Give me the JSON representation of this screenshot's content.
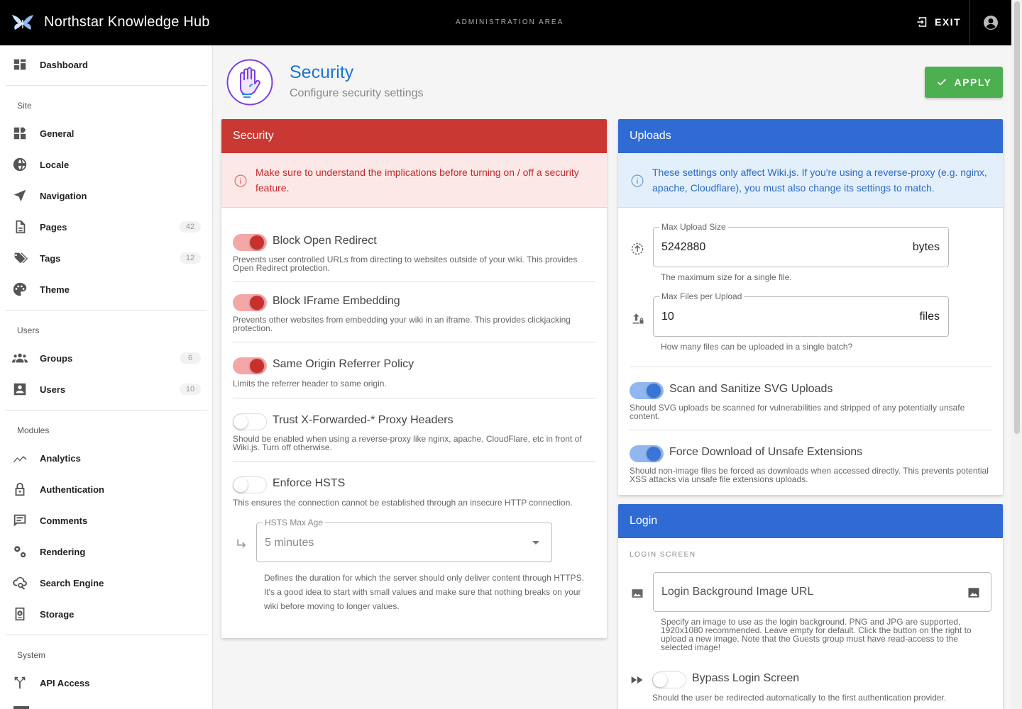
{
  "header": {
    "title": "Northstar Knowledge Hub",
    "area": "ADMINISTRATION AREA",
    "exit_label": "EXIT"
  },
  "sidebar": {
    "dashboard": "Dashboard",
    "site_header": "Site",
    "site_items": [
      {
        "label": "General",
        "icon": "general-icon"
      },
      {
        "label": "Locale",
        "icon": "globe-icon"
      },
      {
        "label": "Navigation",
        "icon": "navigation-icon"
      },
      {
        "label": "Pages",
        "icon": "page-icon",
        "count": "42"
      },
      {
        "label": "Tags",
        "icon": "tag-icon",
        "count": "12"
      },
      {
        "label": "Theme",
        "icon": "palette-icon"
      }
    ],
    "users_header": "Users",
    "users_items": [
      {
        "label": "Groups",
        "icon": "groups-icon",
        "count": "6"
      },
      {
        "label": "Users",
        "icon": "user-icon",
        "count": "10"
      }
    ],
    "modules_header": "Modules",
    "modules_items": [
      {
        "label": "Analytics",
        "icon": "analytics-icon"
      },
      {
        "label": "Authentication",
        "icon": "lock-icon"
      },
      {
        "label": "Comments",
        "icon": "comment-icon"
      },
      {
        "label": "Rendering",
        "icon": "gears-icon"
      },
      {
        "label": "Search Engine",
        "icon": "search-icon"
      },
      {
        "label": "Storage",
        "icon": "storage-icon"
      }
    ],
    "system_header": "System",
    "system_items": [
      {
        "label": "API Access",
        "icon": "api-icon"
      }
    ]
  },
  "page": {
    "title": "Security",
    "subtitle": "Configure security settings",
    "apply_label": "APPLY"
  },
  "security": {
    "header": "Security",
    "alert": "Make sure to understand the implications before turning on / off a security feature.",
    "settings": [
      {
        "label": "Block Open Redirect",
        "hint": "Prevents user controlled URLs from directing to websites outside of your wiki. This provides Open Redirect protection.",
        "on": true
      },
      {
        "label": "Block IFrame Embedding",
        "hint": "Prevents other websites from embedding your wiki in an iframe. This provides clickjacking protection.",
        "on": true
      },
      {
        "label": "Same Origin Referrer Policy",
        "hint": "Limits the referrer header to same origin.",
        "on": true
      },
      {
        "label": "Trust X-Forwarded-* Proxy Headers",
        "hint": "Should be enabled when using a reverse-proxy like nginx, apache, CloudFlare, etc in front of Wiki.js. Turn off otherwise.",
        "on": false
      },
      {
        "label": "Enforce HSTS",
        "hint": "This ensures the connection cannot be established through an insecure HTTP connection.",
        "on": false
      }
    ],
    "hsts": {
      "label": "HSTS Max Age",
      "value": "5 minutes",
      "hint1": "Defines the duration for which the server should only deliver content through HTTPS.",
      "hint2": "It's a good idea to start with small values and make sure that nothing breaks on your wiki before moving to longer values."
    }
  },
  "uploads": {
    "header": "Uploads",
    "alert": "These settings only affect Wiki.js. If you're using a reverse-proxy (e.g. nginx, apache, Cloudflare), you must also change its settings to match.",
    "max_size": {
      "label": "Max Upload Size",
      "value": "5242880",
      "suffix": "bytes",
      "hint": "The maximum size for a single file."
    },
    "max_files": {
      "label": "Max Files per Upload",
      "value": "10",
      "suffix": "files",
      "hint": "How many files can be uploaded in a single batch?"
    },
    "settings": [
      {
        "label": "Scan and Sanitize SVG Uploads",
        "hint": "Should SVG uploads be scanned for vulnerabilities and stripped of any potentially unsafe content.",
        "on": true
      },
      {
        "label": "Force Download of Unsafe Extensions",
        "hint": "Should non-image files be forced as downloads when accessed directly. This prevents potential XSS attacks via unsafe file extensions uploads.",
        "on": true
      }
    ]
  },
  "login": {
    "header": "Login",
    "section": "LOGIN SCREEN",
    "bg_placeholder": "Login Background Image URL",
    "bg_hint": "Specify an image to use as the login background. PNG and JPG are supported, 1920x1080 recommended. Leave empty for default. Click the button on the right to upload a new image. Note that the Guests group must have read-access to the selected image!",
    "bypass": {
      "label": "Bypass Login Screen",
      "hint": "Should the user be redirected automatically to the first authentication provider.",
      "on": false
    }
  },
  "colors": {
    "security_header": "#c93832",
    "uploads_header": "#2f6bd3",
    "apply": "#4caf50",
    "accent": "#1976d2"
  }
}
